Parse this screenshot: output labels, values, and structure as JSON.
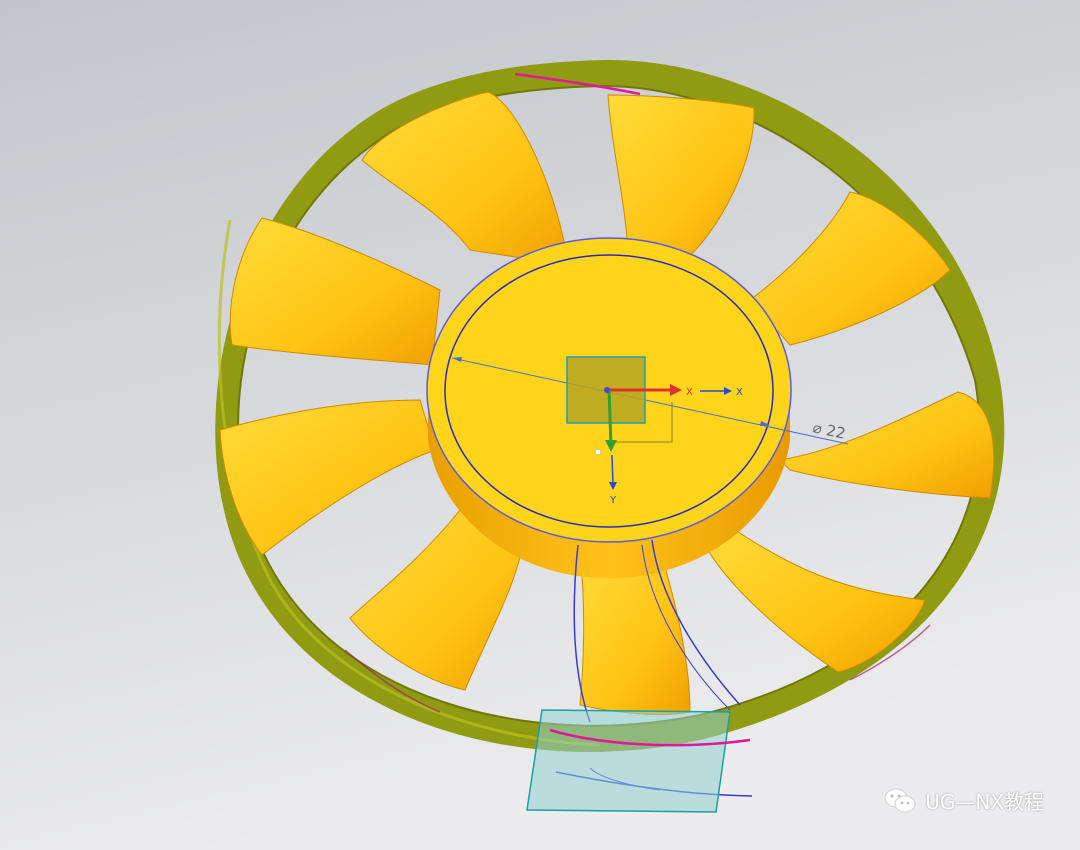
{
  "viewport": {
    "background_top": "#c4c7cc",
    "background_bottom": "#e9eaec"
  },
  "model": {
    "ring_color": "#8f9a0f",
    "blade_color": "#ffcc1a",
    "hub_color": "#ffd21a",
    "sketch_color": "#3a3ad6",
    "highlight_color": "#e0189a",
    "blade_count": 9
  },
  "csys": {
    "x_label": "X",
    "x_axis_label": "X",
    "y_label": "Y",
    "x_color": "#e03030",
    "y_color": "#30a030"
  },
  "dimension": {
    "text": "⌀ 22"
  },
  "watermark": {
    "icon": "wechat-icon",
    "text": "UG—NX教程"
  }
}
